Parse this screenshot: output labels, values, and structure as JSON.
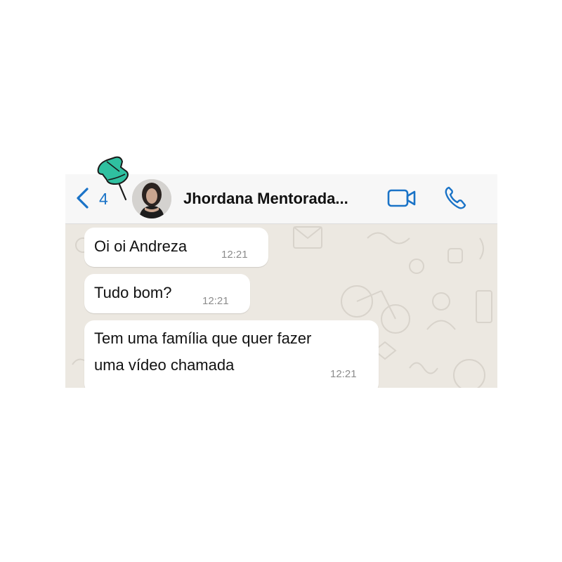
{
  "header": {
    "back_count": "4",
    "contact_name": "Jhordana Mentorada..."
  },
  "messages": [
    {
      "text_lines": [
        "Oi oi Andreza"
      ],
      "time": "12:21"
    },
    {
      "text_lines": [
        "Tudo bom?"
      ],
      "time": "12:21"
    },
    {
      "text_lines": [
        "Tem uma família que quer fazer",
        "uma vídeo chamada"
      ],
      "time": "12:21"
    }
  ],
  "colors": {
    "accent": "#1a73c7",
    "pin": "#2fc0a0",
    "chat_background": "#ece8e1",
    "bubble": "#ffffff"
  },
  "icons": [
    "back-chevron-icon",
    "video-call-icon",
    "phone-icon",
    "pushpin-icon"
  ]
}
